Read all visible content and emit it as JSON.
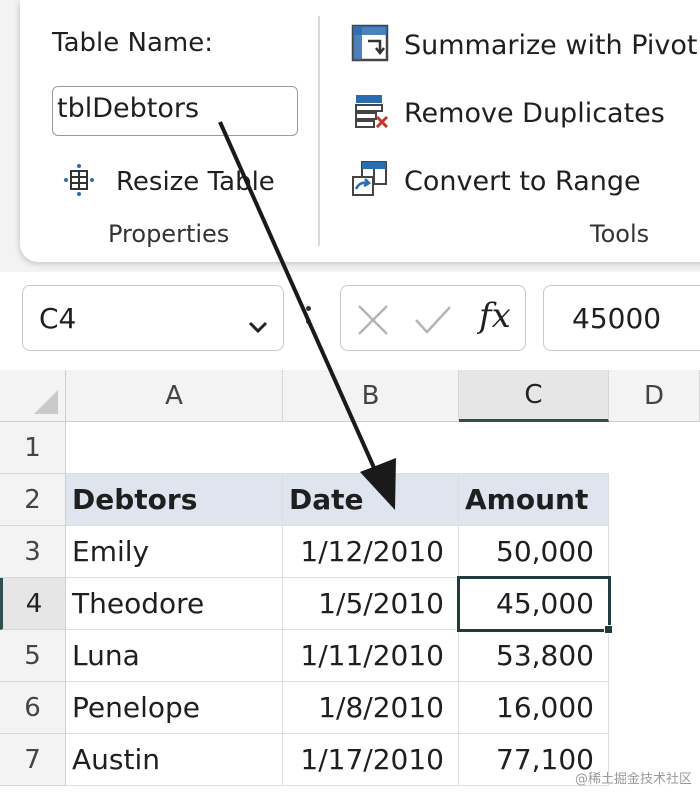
{
  "ribbon": {
    "properties": {
      "table_name_label": "Table Name:",
      "table_name_value": "tblDebtors",
      "resize_label": "Resize Table",
      "group_label": "Properties"
    },
    "tools": {
      "summarize_label": "Summarize with Pivot",
      "remove_duplicates_label": "Remove Duplicates",
      "convert_label": "Convert to Range",
      "group_label": "Tools"
    }
  },
  "formula_bar": {
    "name_box": "C4",
    "formula": "45000"
  },
  "grid": {
    "columns": [
      "A",
      "B",
      "C",
      "D"
    ],
    "rows": [
      "1",
      "2",
      "3",
      "4",
      "5",
      "6",
      "7"
    ],
    "active_cell": "C4",
    "table_headers": [
      "Debtors",
      "Date",
      "Amount"
    ],
    "table_rows": [
      [
        "Emily",
        "1/12/2010",
        "50,000"
      ],
      [
        "Theodore",
        "1/5/2010",
        "45,000"
      ],
      [
        "Luna",
        "1/11/2010",
        "53,800"
      ],
      [
        "Penelope",
        "1/8/2010",
        "16,000"
      ],
      [
        "Austin",
        "1/17/2010",
        "77,100"
      ]
    ]
  },
  "watermark": "@稀土掘金技术社区",
  "colors": {
    "header_fill": "#dfe5ee",
    "selection": "#1f3b3b",
    "annotation_arrow": "#1a1a1a"
  }
}
